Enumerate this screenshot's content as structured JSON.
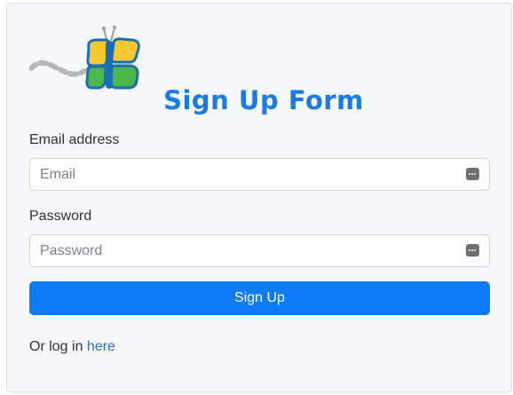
{
  "form": {
    "title": "Sign Up Form",
    "logo_icon": "butterfly-logo-icon",
    "email": {
      "label": "Email address",
      "placeholder": "Email",
      "value": "",
      "icon": "password-manager-key-icon"
    },
    "password": {
      "label": "Password",
      "placeholder": "Password",
      "value": "",
      "icon": "password-manager-key-icon"
    },
    "submit_label": "Sign Up",
    "login_prompt": "Or log in",
    "login_link": "here"
  },
  "colors": {
    "card_background": "#f6f7f9",
    "title": "#1a7be6",
    "button": "#0d7bf5",
    "link": "#2f72c4"
  }
}
